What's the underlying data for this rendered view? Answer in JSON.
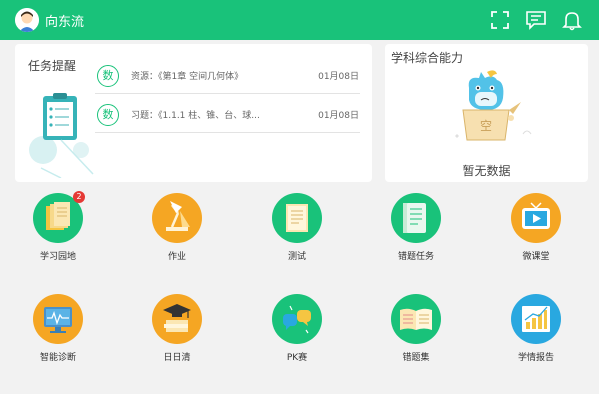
{
  "header": {
    "username": "向东流"
  },
  "tasks": {
    "title": "任务提醒",
    "items": [
      {
        "badge": "数",
        "text": "资源：《第1章 空间几何体》",
        "date": "01月08日"
      },
      {
        "badge": "数",
        "text": "习题：《1.1.1 柱、锥、台、球...",
        "date": "01月08日"
      }
    ]
  },
  "ability": {
    "title": "学科综合能力",
    "empty_text": "暂无数据",
    "mascot_char": "空"
  },
  "modules": [
    {
      "label": "学习园地",
      "color": "#19c27a",
      "icon": "notebooks-icon",
      "badge": "2"
    },
    {
      "label": "作业",
      "color": "#f5a623",
      "icon": "desk-lamp-icon"
    },
    {
      "label": "测试",
      "color": "#19c27a",
      "icon": "test-paper-icon"
    },
    {
      "label": "错题任务",
      "color": "#19c27a",
      "icon": "wrong-question-task-icon"
    },
    {
      "label": "微课堂",
      "color": "#f5a623",
      "icon": "video-class-icon"
    },
    {
      "label": "智能诊断",
      "color": "#f5a623",
      "icon": "diagnosis-monitor-icon"
    },
    {
      "label": "日日清",
      "color": "#f5a623",
      "icon": "graduation-books-icon"
    },
    {
      "label": "PK赛",
      "color": "#19c27a",
      "icon": "pk-chat-icon"
    },
    {
      "label": "错题集",
      "color": "#19c27a",
      "icon": "open-book-icon"
    },
    {
      "label": "学情报告",
      "color": "#29a8e0",
      "icon": "bar-chart-report-icon"
    }
  ]
}
